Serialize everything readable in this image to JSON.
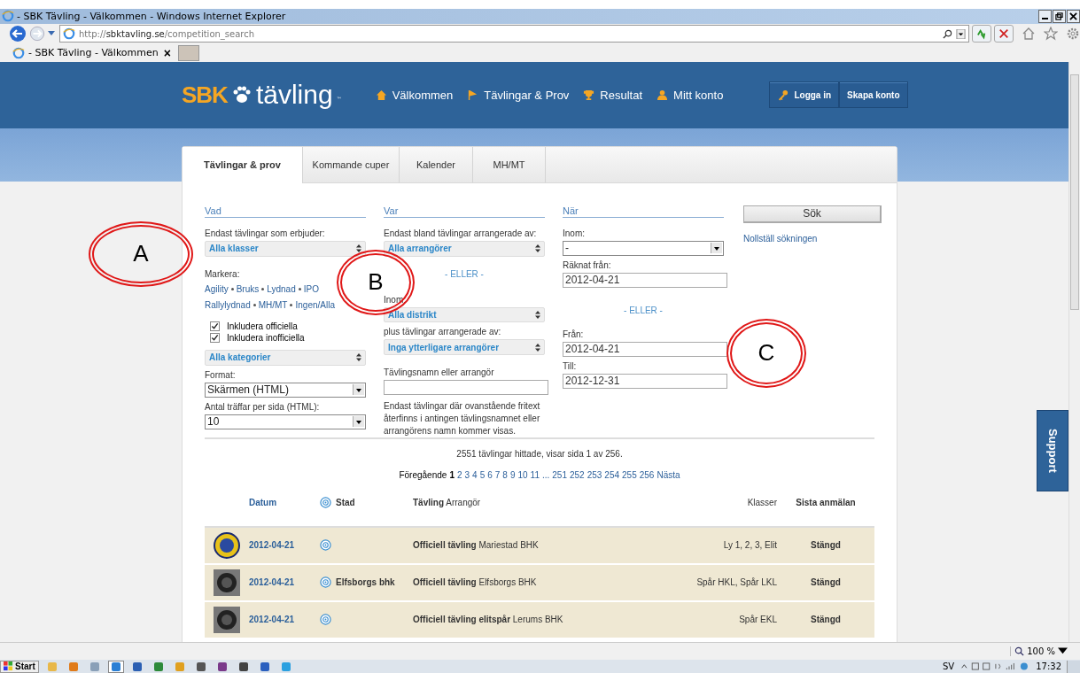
{
  "window": {
    "title": "- SBK Tävling - Välkommen - Windows Internet Explorer"
  },
  "address_bar": {
    "url_prefix": "http://",
    "url_host": "sbktavling.se",
    "url_path": "/competition_search"
  },
  "browser_tabs": [
    {
      "label": "- SBK Tävling - Välkommen",
      "close": "×",
      "selected": true
    }
  ],
  "header": {
    "logo_bold": "SBK",
    "logo_text": "tävling",
    "logo_tm": "™",
    "nav": [
      {
        "label": "Välkommen",
        "kind": "home"
      },
      {
        "label": "Tävlingar & Prov",
        "kind": "flag"
      },
      {
        "label": "Resultat",
        "kind": "trophy"
      },
      {
        "label": "Mitt konto",
        "kind": "person"
      }
    ],
    "buttons": [
      {
        "label": "Logga in",
        "kind": "key"
      },
      {
        "label": "Skapa konto",
        "kind": "plain"
      }
    ]
  },
  "tabs": [
    {
      "label": "Tävlingar & prov",
      "selected": true
    },
    {
      "label": "Kommande cuper",
      "selected": false
    },
    {
      "label": "Kalender",
      "selected": false
    },
    {
      "label": "MH/MT",
      "selected": false
    }
  ],
  "vad": {
    "heading": "Vad",
    "classes_label": "Endast tävlingar som erbjuder:",
    "classes_value": "Alla klasser",
    "mark_label": "Markera:",
    "mark_lines": [
      [
        "Agility",
        "Bruks",
        "Lydnad",
        "IPO"
      ],
      [
        "Rallylydnad",
        "MH/MT",
        "Ingen/Alla"
      ]
    ],
    "checkboxes": [
      {
        "label": "Inkludera officiella",
        "checked": true
      },
      {
        "label": "Inkludera inofficiella",
        "checked": true
      }
    ],
    "category_value": "Alla kategorier",
    "format_label": "Format:",
    "format_value": "Skärmen (HTML)",
    "per_page_label": "Antal träffar per sida (HTML):",
    "per_page_value": "10"
  },
  "var": {
    "heading": "Var",
    "org_label": "Endast bland tävlingar arrangerade av:",
    "org_value": "Alla arrangörer",
    "or": "- ELLER -",
    "within_label": "Inom:",
    "district_value": "Alla distrikt",
    "plus_label": "plus tävlingar arrangerade av:",
    "plus_value": "Inga ytterligare arrangörer",
    "name_label": "Tävlingsnamn eller arrangör",
    "help": "Endast tävlingar där ovanstående fritext återfinns i antingen tävlingsnamnet eller arrangörens namn kommer visas."
  },
  "nar": {
    "heading": "När",
    "within_label": "Inom:",
    "within_value": "-",
    "from_calc_label": "Räknat från:",
    "from_calc_value": "2012-04-21",
    "or": "- ELLER -",
    "from_label": "Från:",
    "from_value": "2012-04-21",
    "to_label": "Till:",
    "to_value": "2012-12-31"
  },
  "search_button": "Sök",
  "reset_link": "Nollställ sökningen",
  "summary": "2551 tävlingar hittade, visar sida 1 av 256.",
  "pagination": {
    "previous": "Föregående",
    "pages": [
      {
        "label": "1",
        "selected": true
      },
      {
        "label": "2",
        "selected": false
      },
      {
        "label": "3",
        "selected": false
      },
      {
        "label": "4",
        "selected": false
      },
      {
        "label": "5",
        "selected": false
      },
      {
        "label": "6",
        "selected": false
      },
      {
        "label": "7",
        "selected": false
      },
      {
        "label": "8",
        "selected": false
      },
      {
        "label": "9",
        "selected": false
      },
      {
        "label": "10",
        "selected": false
      },
      {
        "label": "11",
        "selected": false
      },
      {
        "label": "...",
        "selected": false
      },
      {
        "label": "251",
        "selected": false
      },
      {
        "label": "252",
        "selected": false
      },
      {
        "label": "253",
        "selected": false
      },
      {
        "label": "254",
        "selected": false
      },
      {
        "label": "255",
        "selected": false
      },
      {
        "label": "256",
        "selected": false
      }
    ],
    "next": "Nästa"
  },
  "table": {
    "columns": [
      "Datum",
      "Stad",
      "**Tävling** Arrangör",
      "Klasser",
      "Sista anmälan"
    ],
    "rows": [
      {
        "kind": "gold",
        "date": "2012-04-21",
        "city": "",
        "competition": "**Officiell tävling** Mariestad BHK",
        "classes": "Ly 1, 2, 3, Elit",
        "deadline": "Stängd"
      },
      {
        "kind": "grey",
        "date": "2012-04-21",
        "city": "Elfsborgs bhk",
        "competition": "**Officiell tävling** Elfsborgs BHK",
        "classes": "Spår HKL, Spår LKL",
        "deadline": "Stängd"
      },
      {
        "kind": "grey",
        "date": "2012-04-21",
        "city": "",
        "competition": "**Officiell tävling elitspår** Lerums BHK",
        "classes": "Spår EKL",
        "deadline": "Stängd"
      }
    ]
  },
  "support_tab": "Support",
  "annotations": [
    "A",
    "B",
    "C"
  ],
  "status_bar": {
    "zoom": "100 %"
  },
  "taskbar": {
    "start": "Start",
    "apps": [
      {
        "selected": false
      },
      {
        "selected": false
      },
      {
        "selected": false
      },
      {
        "selected": true
      },
      {
        "selected": false
      },
      {
        "selected": false
      },
      {
        "selected": false
      },
      {
        "selected": false
      },
      {
        "selected": false
      },
      {
        "selected": false
      },
      {
        "selected": false
      },
      {
        "selected": false
      }
    ],
    "language": "SV",
    "clock": "17:32"
  }
}
